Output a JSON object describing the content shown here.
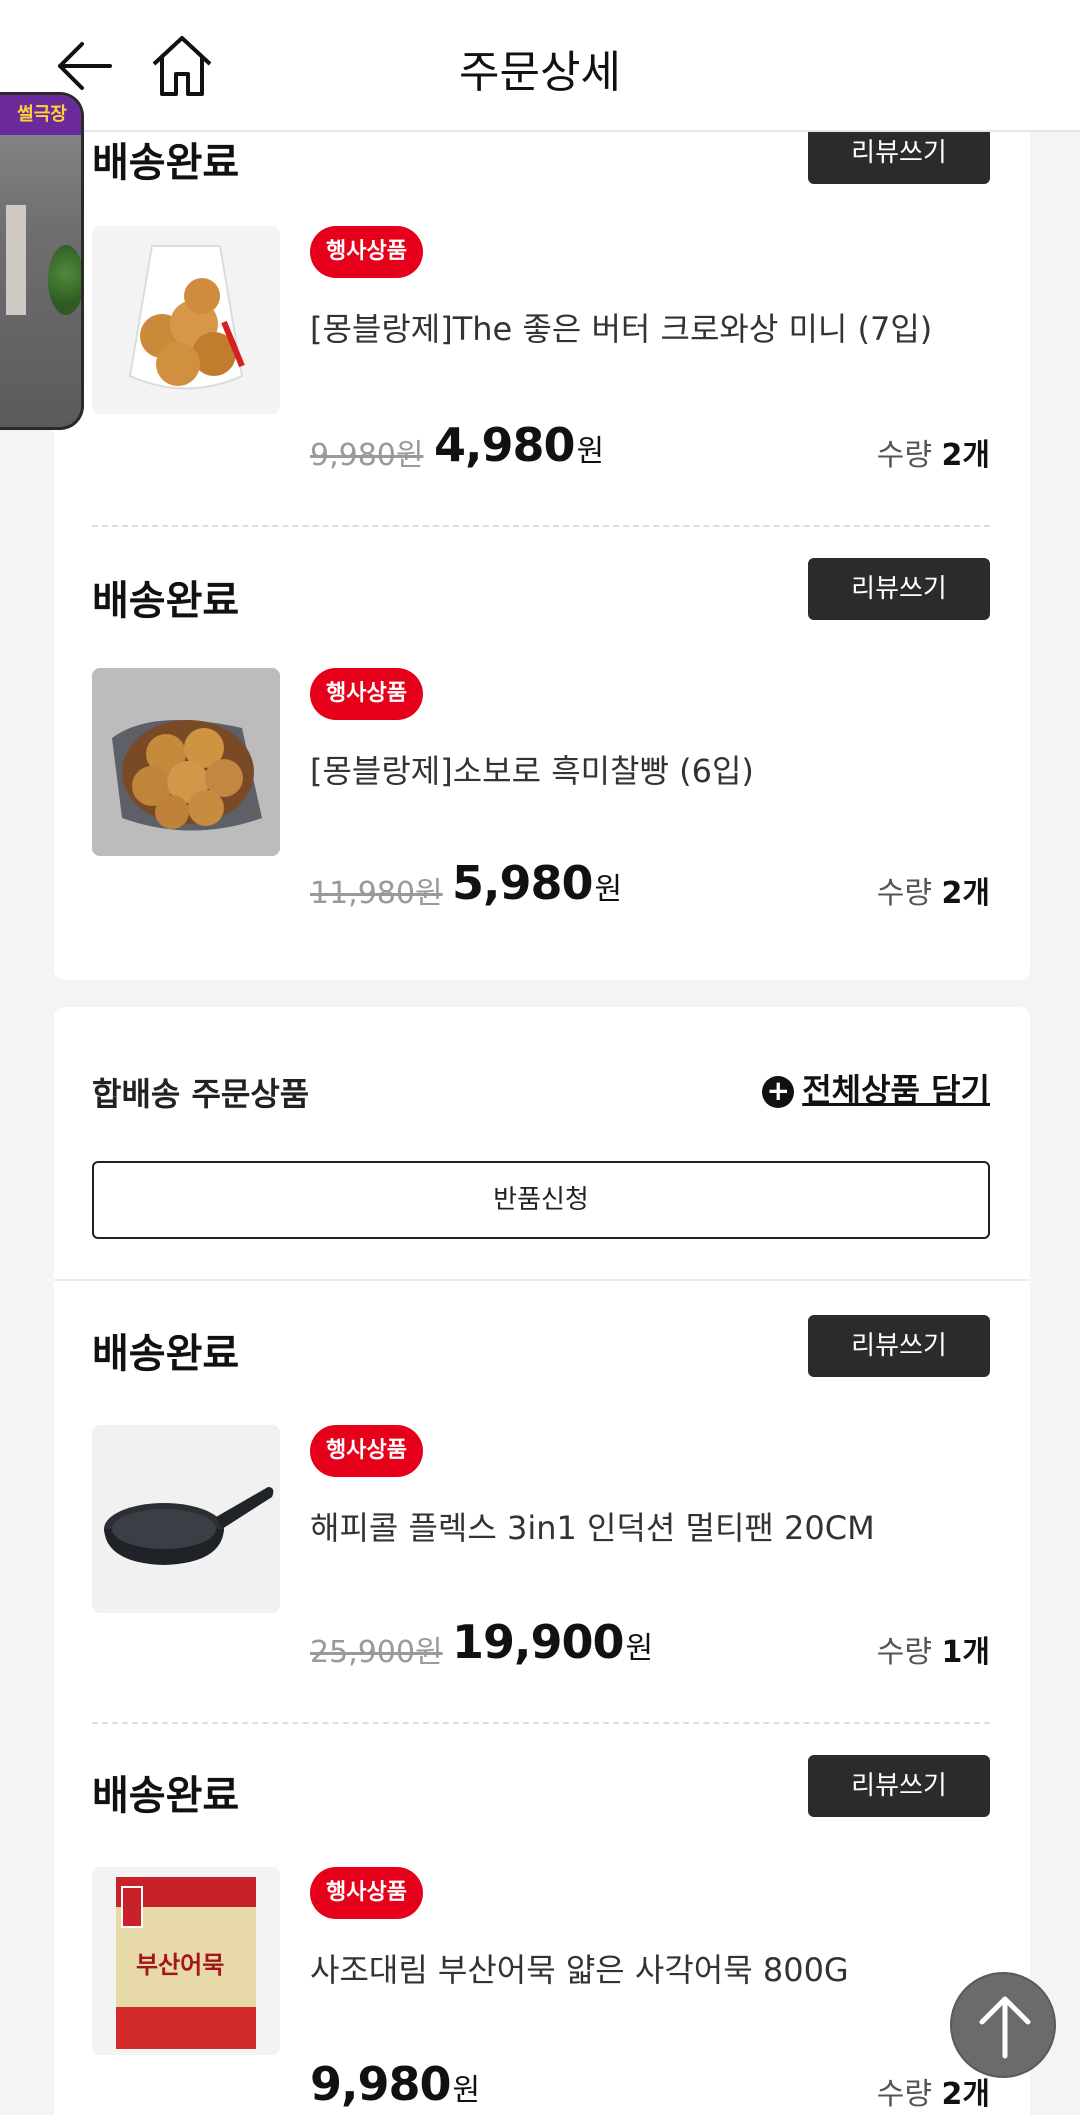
{
  "header": {
    "title": "주문상세"
  },
  "float_video": {
    "label": "썰극장"
  },
  "items_group1": [
    {
      "status": "배송완료",
      "review_label": "리뷰쓰기",
      "badge": "행사상품",
      "name": "[몽블랑제]The 좋은 버터 크로와상 미니 (7입)",
      "orig_price": "9,980원",
      "sale_price": "4,980",
      "won": "원",
      "qty_label": "수량",
      "qty_value": "2개"
    },
    {
      "status": "배송완료",
      "review_label": "리뷰쓰기",
      "badge": "행사상품",
      "name": "[몽블랑제]소보로 흑미찰빵 (6입)",
      "orig_price": "11,980원",
      "sale_price": "5,980",
      "won": "원",
      "qty_label": "수량",
      "qty_value": "2개"
    }
  ],
  "group2": {
    "title": "합배송 주문상품",
    "add_all_label": "전체상품 담기",
    "return_label": "반품신청"
  },
  "items_group2": [
    {
      "status": "배송완료",
      "review_label": "리뷰쓰기",
      "badge": "행사상품",
      "name": "해피콜 플렉스 3in1 인덕션 멀티팬 20CM",
      "orig_price": "25,900원",
      "sale_price": "19,900",
      "won": "원",
      "qty_label": "수량",
      "qty_value": "1개"
    },
    {
      "status": "배송완료",
      "review_label": "리뷰쓰기",
      "badge": "행사상품",
      "name": "사조대림 부산어묵 얇은 사각어묵 800G",
      "orig_price": "",
      "sale_price": "9,980",
      "won": "원",
      "qty_label": "수량",
      "qty_value": "2개",
      "image_text": "부산어묵"
    }
  ],
  "colors": {
    "accent_red": "#e60019",
    "button_dark": "#2b2b2b"
  }
}
